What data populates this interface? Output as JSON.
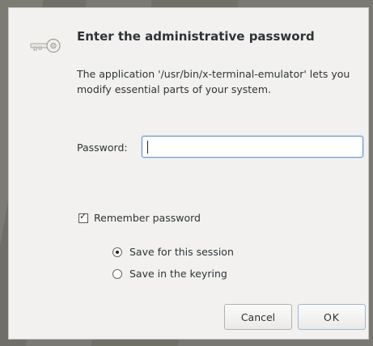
{
  "dialog": {
    "icon": "key-icon",
    "title": "Enter the administrative password",
    "description": "The application '/usr/bin/x-terminal-emulator' lets you modify essential parts of your system.",
    "password": {
      "label": "Password:",
      "value": ""
    },
    "remember": {
      "label": "Remember password",
      "checked": true
    },
    "options": [
      {
        "label": "Save for this session",
        "selected": true
      },
      {
        "label": "Save in the keyring",
        "selected": false
      }
    ],
    "buttons": {
      "cancel": "Cancel",
      "ok": "OK"
    }
  }
}
